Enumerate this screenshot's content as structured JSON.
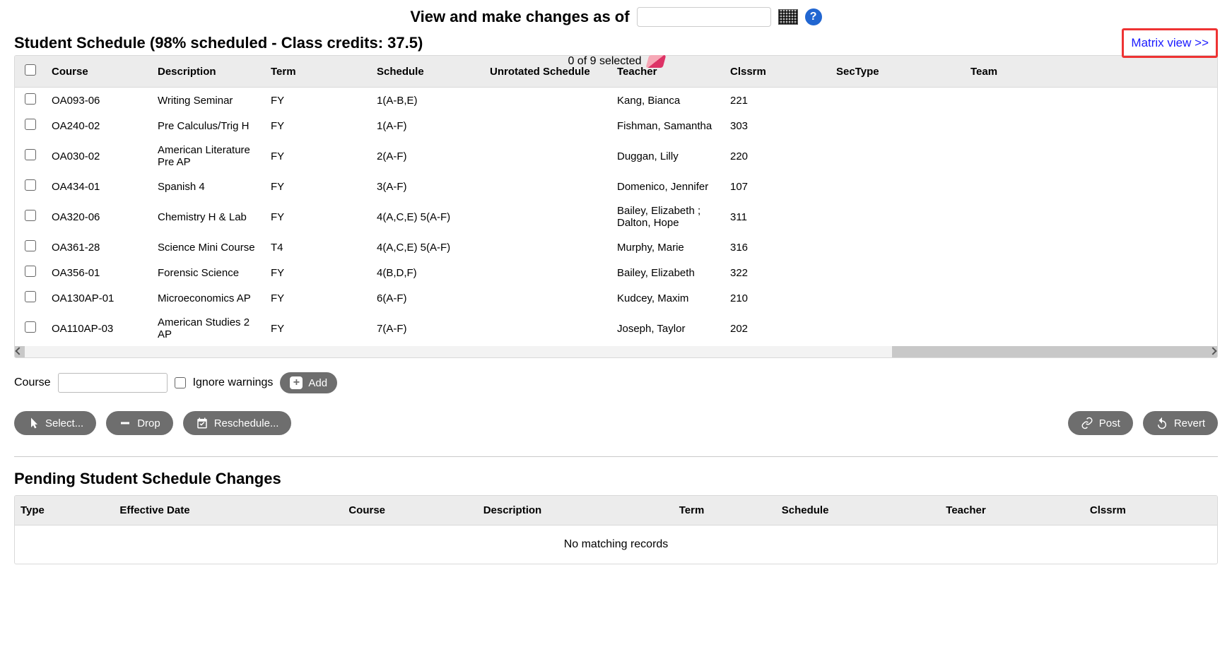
{
  "header": {
    "label": "View and make changes as of",
    "date_value": "",
    "help_glyph": "?"
  },
  "schedule": {
    "title": "Student Schedule (98% scheduled - Class credits: 37.5)",
    "selected_text": "0 of 9 selected",
    "matrix_link": "Matrix view >>",
    "columns": {
      "course": "Course",
      "description": "Description",
      "term": "Term",
      "schedule": "Schedule",
      "unrotated": "Unrotated Schedule",
      "teacher": "Teacher",
      "clssrm": "Clssrm",
      "sectype": "SecType",
      "team": "Team"
    },
    "rows": [
      {
        "course": "OA093-06",
        "description": "Writing Seminar",
        "term": "FY",
        "schedule": "1(A-B,E)",
        "unrotated": "",
        "teacher": "Kang, Bianca",
        "clssrm": "221",
        "sectype": "",
        "team": ""
      },
      {
        "course": "OA240-02",
        "description": "Pre Calculus/Trig H",
        "term": "FY",
        "schedule": "1(A-F)",
        "unrotated": "",
        "teacher": "Fishman, Samantha",
        "clssrm": "303",
        "sectype": "",
        "team": ""
      },
      {
        "course": "OA030-02",
        "description": "American Literature Pre AP",
        "term": "FY",
        "schedule": "2(A-F)",
        "unrotated": "",
        "teacher": "Duggan, Lilly",
        "clssrm": "220",
        "sectype": "",
        "team": ""
      },
      {
        "course": "OA434-01",
        "description": "Spanish 4",
        "term": "FY",
        "schedule": "3(A-F)",
        "unrotated": "",
        "teacher": "Domenico, Jennifer",
        "clssrm": "107",
        "sectype": "",
        "team": ""
      },
      {
        "course": "OA320-06",
        "description": "Chemistry H & Lab",
        "term": "FY",
        "schedule": "4(A,C,E) 5(A-F)",
        "unrotated": "",
        "teacher": "Bailey, Elizabeth ; Dalton, Hope",
        "clssrm": "311",
        "sectype": "",
        "team": ""
      },
      {
        "course": "OA361-28",
        "description": "Science Mini Course",
        "term": "T4",
        "schedule": "4(A,C,E) 5(A-F)",
        "unrotated": "",
        "teacher": "Murphy, Marie",
        "clssrm": "316",
        "sectype": "",
        "team": ""
      },
      {
        "course": "OA356-01",
        "description": "Forensic Science",
        "term": "FY",
        "schedule": "4(B,D,F)",
        "unrotated": "",
        "teacher": "Bailey, Elizabeth",
        "clssrm": "322",
        "sectype": "",
        "team": ""
      },
      {
        "course": "OA130AP-01",
        "description": "Microeconomics AP",
        "term": "FY",
        "schedule": "6(A-F)",
        "unrotated": "",
        "teacher": "Kudcey, Maxim",
        "clssrm": "210",
        "sectype": "",
        "team": ""
      },
      {
        "course": "OA110AP-03",
        "description": "American Studies 2 AP",
        "term": "FY",
        "schedule": "7(A-F)",
        "unrotated": "",
        "teacher": "Joseph, Taylor",
        "clssrm": "202",
        "sectype": "",
        "team": ""
      }
    ]
  },
  "add_form": {
    "course_label": "Course",
    "ignore_label": "Ignore warnings",
    "add_label": "Add"
  },
  "buttons": {
    "select": "Select...",
    "drop": "Drop",
    "reschedule": "Reschedule...",
    "post": "Post",
    "revert": "Revert"
  },
  "pending": {
    "title": "Pending Student Schedule Changes",
    "columns": {
      "type": "Type",
      "eff_date": "Effective Date",
      "course": "Course",
      "description": "Description",
      "term": "Term",
      "schedule": "Schedule",
      "teacher": "Teacher",
      "clssrm": "Clssrm"
    },
    "empty": "No matching records"
  }
}
